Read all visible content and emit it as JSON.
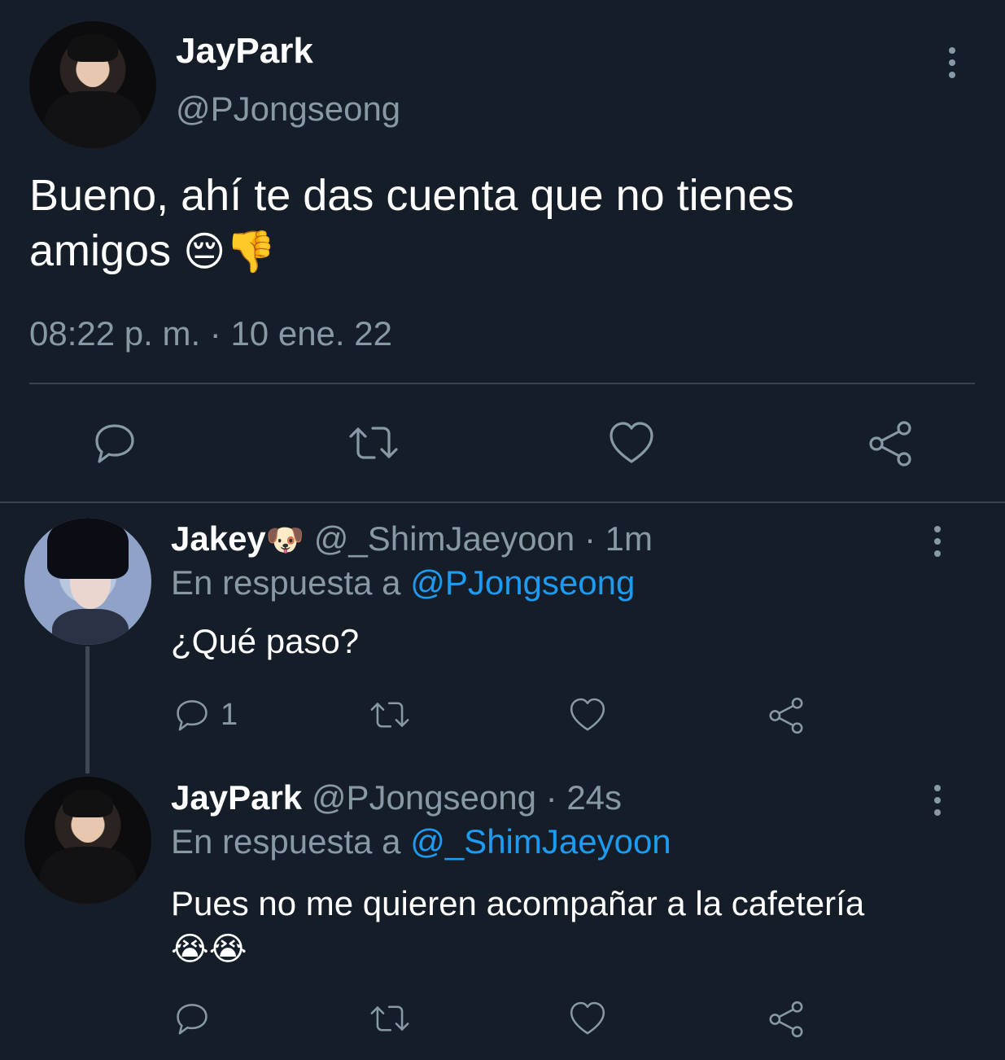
{
  "main_tweet": {
    "display_name": "JayPark",
    "handle": "@PJongseong",
    "text_line1": "Bueno, ahí te das cuenta que no tienes",
    "text_line2": "amigos",
    "text_emojis": "😔👎",
    "timestamp": "08:22 p. m. · 10 ene. 22"
  },
  "reply1": {
    "display_name": "Jakey",
    "name_emoji": "🐶",
    "handle": "@_ShimJaeyoon",
    "time": "· 1m",
    "reply_prefix": "En respuesta a",
    "reply_to": "@PJongseong",
    "text": "¿Qué paso?",
    "reply_count": "1"
  },
  "reply2": {
    "display_name": "JayPark",
    "handle": "@PJongseong",
    "time": "· 24s",
    "reply_prefix": "En respuesta a",
    "reply_to": "@_ShimJaeyoon",
    "text": "Pues no me quieren acompañar a la cafetería",
    "text_emojis": "😭😭"
  },
  "icons": [
    "reply-icon",
    "retweet-icon",
    "like-icon",
    "share-icon",
    "more-options-icon"
  ],
  "colors": {
    "background": "#151e28",
    "text": "#ffffff",
    "muted": "#8899a6",
    "link": "#1d9bf0",
    "divider": "#38444d"
  }
}
